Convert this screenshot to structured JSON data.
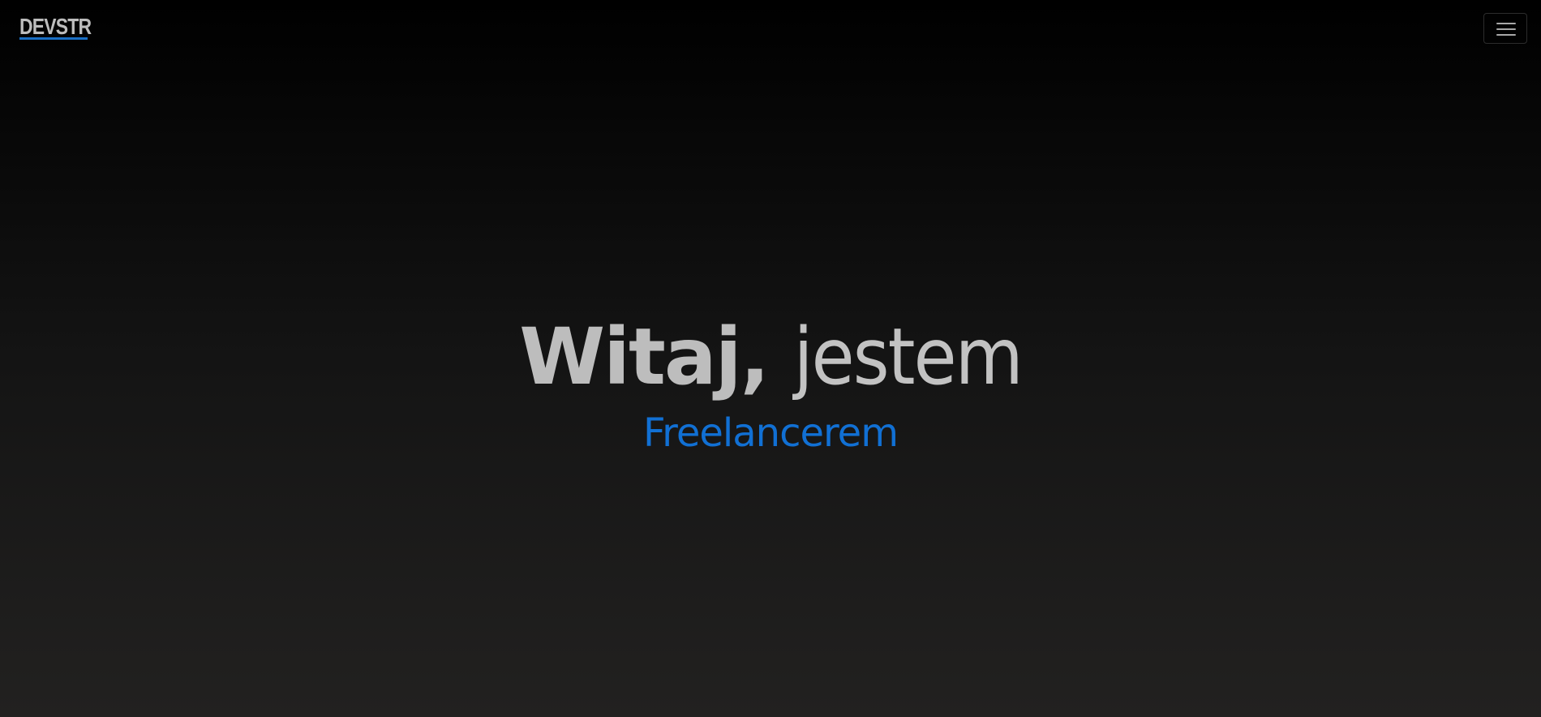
{
  "navbar": {
    "logo_text": "DEVSTR",
    "menu_toggle_icon": "hamburger-menu-icon"
  },
  "hero": {
    "greeting_bold": "Witaj,",
    "greeting_light": "jestem",
    "role": "Freelancerem"
  },
  "colors": {
    "accent": "#1170d4",
    "text": "#bdbdbd",
    "background_top": "#000000",
    "background_bottom": "#222120"
  }
}
